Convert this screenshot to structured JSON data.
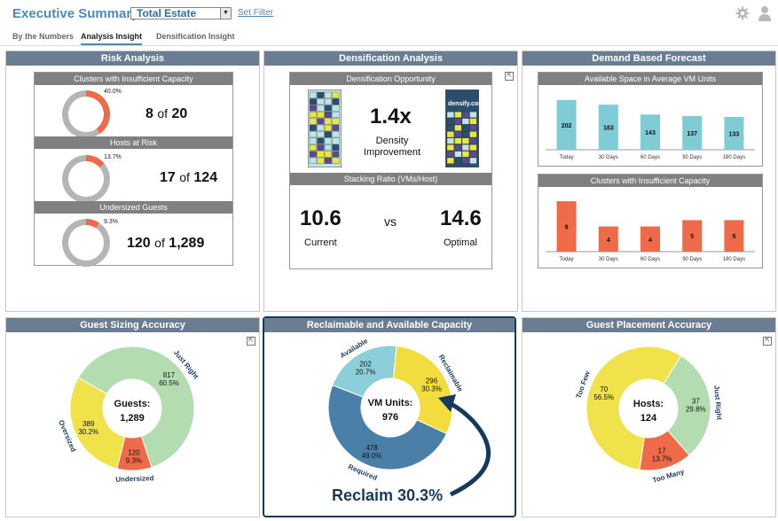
{
  "header": {
    "title": "Executive Summary for",
    "selector_value": "Total Estate",
    "set_filter": "Set Filter"
  },
  "tabs": [
    {
      "label": "By the Numbers",
      "active": false
    },
    {
      "label": "Analysis Insight",
      "active": true
    },
    {
      "label": "Densification Insight",
      "active": false
    }
  ],
  "risk": {
    "title": "Risk Analysis",
    "items": [
      {
        "label": "Clusters with Insufficient Capacity",
        "pct_label": "40.0%",
        "fraction": 0.4,
        "value": "8",
        "of": "of",
        "total": "20"
      },
      {
        "label": "Hosts at Risk",
        "pct_label": "13.7%",
        "fraction": 0.137,
        "value": "17",
        "of": "of",
        "total": "124"
      },
      {
        "label": "Undersized Guests",
        "pct_label": "9.3%",
        "fraction": 0.093,
        "value": "120",
        "of": "of",
        "total": "1,289"
      }
    ]
  },
  "densification": {
    "title": "Densification Analysis",
    "opportunity_label": "Densification Opportunity",
    "improvement": "1.4x",
    "improvement_line1": "Density",
    "improvement_line2": "Improvement",
    "logo_text_a": "densify",
    "logo_text_b": ".com",
    "stacking_label": "Stacking Ratio (VMs/Host)",
    "current_value": "10.6",
    "current_label": "Current",
    "vs": "vs",
    "optimal_value": "14.6",
    "optimal_label": "Optimal"
  },
  "forecast": {
    "title": "Demand Based Forecast",
    "available_title": "Available Space in Average VM Units",
    "clusters_title": "Clusters with Insufficient Capacity"
  },
  "chart_data": [
    {
      "type": "bar",
      "title": "Available Space in Average VM Units",
      "categories": [
        "Today",
        "30 Days",
        "60 Days",
        "90 Days",
        "180 Days"
      ],
      "values": [
        202,
        183,
        143,
        137,
        133
      ],
      "ylim": [
        0,
        230
      ],
      "color": "#7fcbd6"
    },
    {
      "type": "bar",
      "title": "Clusters with Insufficient Capacity",
      "categories": [
        "Today",
        "30 Days",
        "60 Days",
        "90 Days",
        "180 Days"
      ],
      "values": [
        8,
        4,
        4,
        5,
        5
      ],
      "ylim": [
        0,
        9
      ],
      "color": "#ee6a48"
    },
    {
      "type": "pie",
      "title": "Guest Sizing Accuracy",
      "center_label": "Guests:",
      "center_value": "1,289",
      "slices": [
        {
          "name": "Just Right",
          "value": 817,
          "pct": "60.5%",
          "color": "#b3ddb0"
        },
        {
          "name": "Undersized",
          "value": 120,
          "pct": "9.3%",
          "color": "#ee6a48"
        },
        {
          "name": "Oversized",
          "value": 389,
          "pct": "30.2%",
          "color": "#efe24a"
        }
      ]
    },
    {
      "type": "pie",
      "title": "Reclaimable and Available Capacity",
      "center_label": "VM Units:",
      "center_value": "976",
      "slices": [
        {
          "name": "Reclaimable",
          "value": 296,
          "pct": "30.3%",
          "color": "#f2dc3e"
        },
        {
          "name": "Required",
          "value": 478,
          "pct": "49.0%",
          "color": "#4a7fa8"
        },
        {
          "name": "Available",
          "value": 202,
          "pct": "20.7%",
          "color": "#8ccfd8"
        }
      ]
    },
    {
      "type": "pie",
      "title": "Guest Placement Accuracy",
      "center_label": "Hosts:",
      "center_value": "124",
      "slices": [
        {
          "name": "Just Right",
          "value": 37,
          "pct": "29.8%",
          "color": "#b3ddb0"
        },
        {
          "name": "Too Many",
          "value": 17,
          "pct": "13.7%",
          "color": "#ee6a48"
        },
        {
          "name": "Too Few",
          "value": 70,
          "pct": "56.5%",
          "color": "#efe24a"
        }
      ]
    }
  ],
  "guest_sizing": {
    "title": "Guest Sizing Accuracy"
  },
  "reclaim": {
    "title": "Reclaimable and Available Capacity",
    "callout": "Reclaim 30.3%"
  },
  "placement": {
    "title": "Guest Placement Accuracy"
  },
  "colors": {
    "header_blue": "#4a8bb8",
    "panel_title": "#6b7d92",
    "orange": "#ee6a48",
    "gray_ring": "#b5b5b5",
    "navy": "#163a5c"
  }
}
